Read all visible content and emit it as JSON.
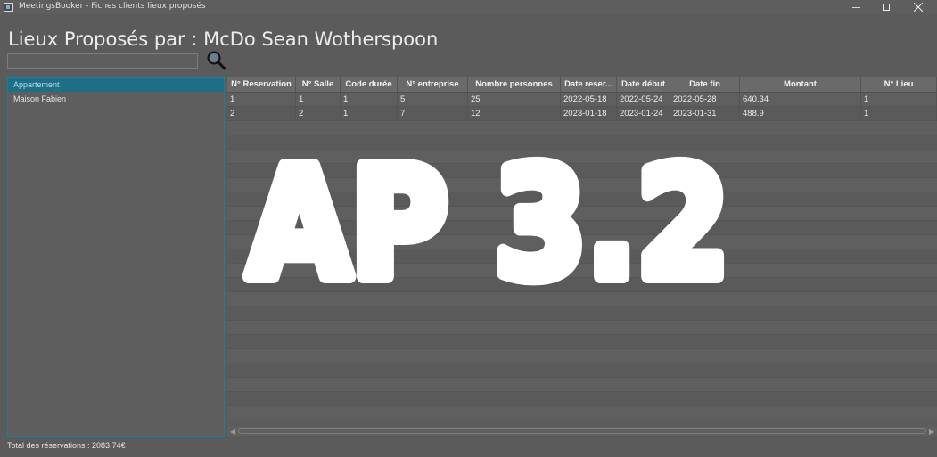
{
  "window": {
    "title": "MeetingsBooker - Fiches clients lieux proposés"
  },
  "page": {
    "heading": "Lieux Proposés par : McDo Sean Wotherspoon"
  },
  "search": {
    "value": "",
    "placeholder": ""
  },
  "places": {
    "items": [
      {
        "label": "Appartement",
        "selected": true
      },
      {
        "label": "Maison Fabien",
        "selected": false
      }
    ]
  },
  "table": {
    "columns": [
      "N° Reservation",
      "N° Salle",
      "Code durée",
      "N° entreprise",
      "Nombre personnes",
      "Date reser...",
      "Date début",
      "Date fin",
      "Montant",
      "N° Lieu"
    ],
    "rows": [
      [
        "1",
        "1",
        "1",
        "5",
        "25",
        "2022-05-18",
        "2022-05-24",
        "2022-05-28",
        "640.34",
        "1"
      ],
      [
        "2",
        "2",
        "1",
        "7",
        "12",
        "2023-01-18",
        "2023-01-24",
        "2023-01-31",
        "488.9",
        "1"
      ]
    ]
  },
  "footer": {
    "total": "Total des réservations : 2083.74€"
  },
  "overlay": {
    "text": "AP 3.2"
  },
  "colors": {
    "accent": "#1c6f86",
    "background": "#5b5b5b"
  }
}
